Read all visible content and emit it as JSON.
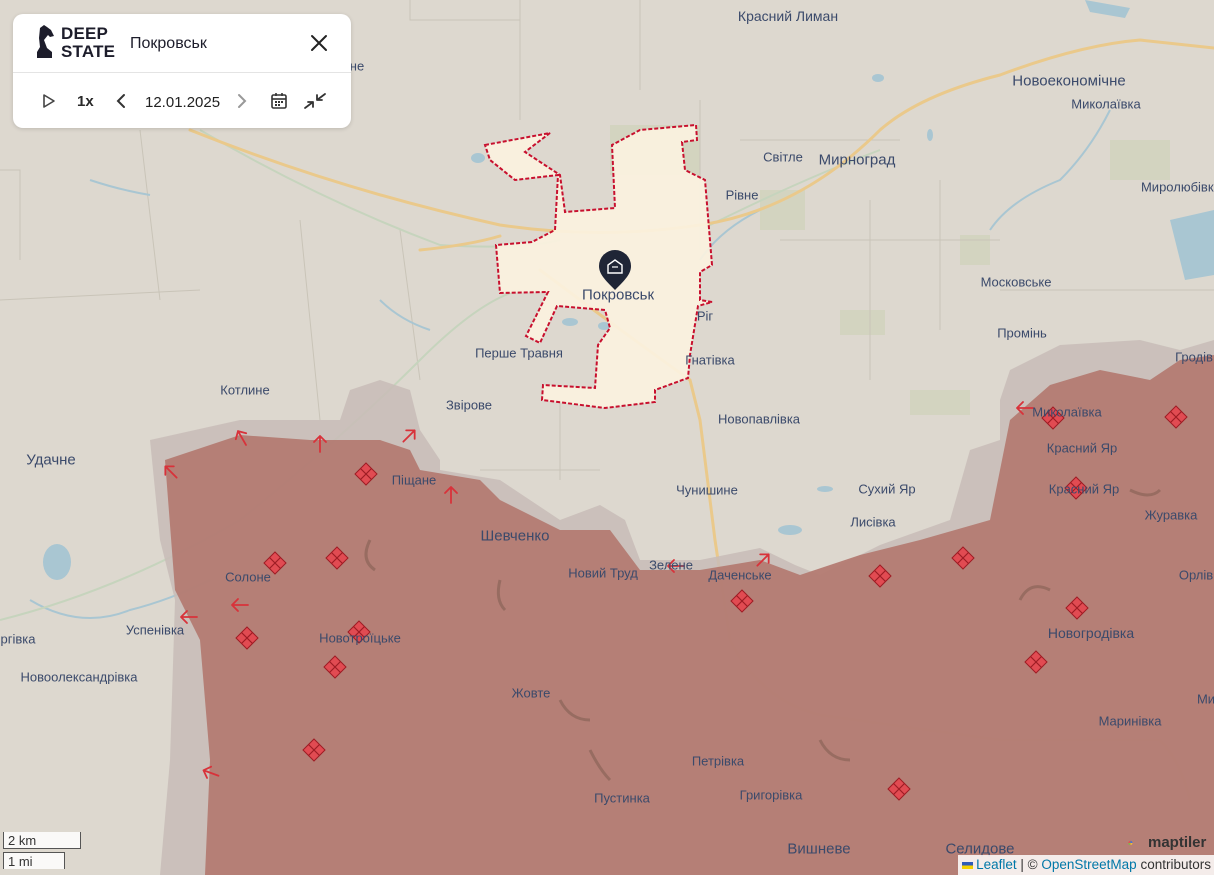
{
  "panel": {
    "brand": "DEEP\nSTATE",
    "city": "Покровськ",
    "speed": "1x",
    "date": "12.01.2025"
  },
  "icons": [
    "logo-horse-icon",
    "close-icon",
    "play-icon",
    "chevron-left-icon",
    "chevron-right-icon",
    "calendar-icon",
    "compress-arrows-icon",
    "building-marker-icon",
    "diamond-strike-icon",
    "arrow-attack-icon"
  ],
  "colors": {
    "map_background": "#ddd8cf",
    "occupied": "#b37b72",
    "contested": "#c8bcb7",
    "city_fill": "#fbf2df",
    "city_border": "#c8102e",
    "road": "#eac98b",
    "water": "#a9c6d2",
    "label": "#3b4a6b"
  },
  "map": {
    "labels": {
      "krasnyi_lyman_n": "Красний Лиман",
      "novoekonomichne": "Новоекономічне",
      "mykolaivka_n": "Миколаївка",
      "svitle": "Світле",
      "myrnohrad": "Мирноград",
      "myroliubivka": "Миролюбівка",
      "rivne": "Рівне",
      "moskovske": "Московське",
      "pokrovsk": "Покровськ",
      "rih": "Ріг",
      "promin": "Промінь",
      "hrodivka": "Гродів",
      "pershe_travnia": "Перше Травня",
      "hnativka": "Гнатівка",
      "kotlyne": "Котлине",
      "zvirove": "Звірове",
      "novopavlivka": "Новопавлівка",
      "mykolaivka_s": "Миколаївка",
      "krasnyi_yar_1": "Красний Яр",
      "krasnyi_yar_2": "Красний Яр",
      "udachne": "Удачне",
      "pishchane": "Піщане",
      "chunyshyne": "Чунишине",
      "sukhyi_yar": "Сухий Яр",
      "zhuravka": "Журавка",
      "lysivka": "Лисівка",
      "shevchenko": "Шевченко",
      "solone": "Солоне",
      "novyi_trud": "Новий Труд",
      "zelene": "Зелене",
      "dachenske": "Даченське",
      "orlivka": "Орлів",
      "orikhivka": "ргівка",
      "uspenivka": "Успенівка",
      "novotroitske": "Новотроїцьке",
      "novohrodivka": "Новогродівка",
      "novooleksandrivka": "Новоолександрівка",
      "zhovte": "Жовте",
      "my_edge": "Ми",
      "marynivka": "Маринівка",
      "petrivka": "Петрівка",
      "pustynka": "Пустинка",
      "hryhorivka": "Григорівка",
      "vyshneve": "Вишневе",
      "selydove": "Селидове",
      "ne_fragment": "не"
    }
  },
  "scale": {
    "km": "2 km",
    "mi": "1 mi"
  },
  "attribution": {
    "leaflet": "Leaflet",
    "sep": " | © ",
    "osm": "OpenStreetMap",
    "contributors": " contributors"
  },
  "maptiler_logo": "maptiler"
}
